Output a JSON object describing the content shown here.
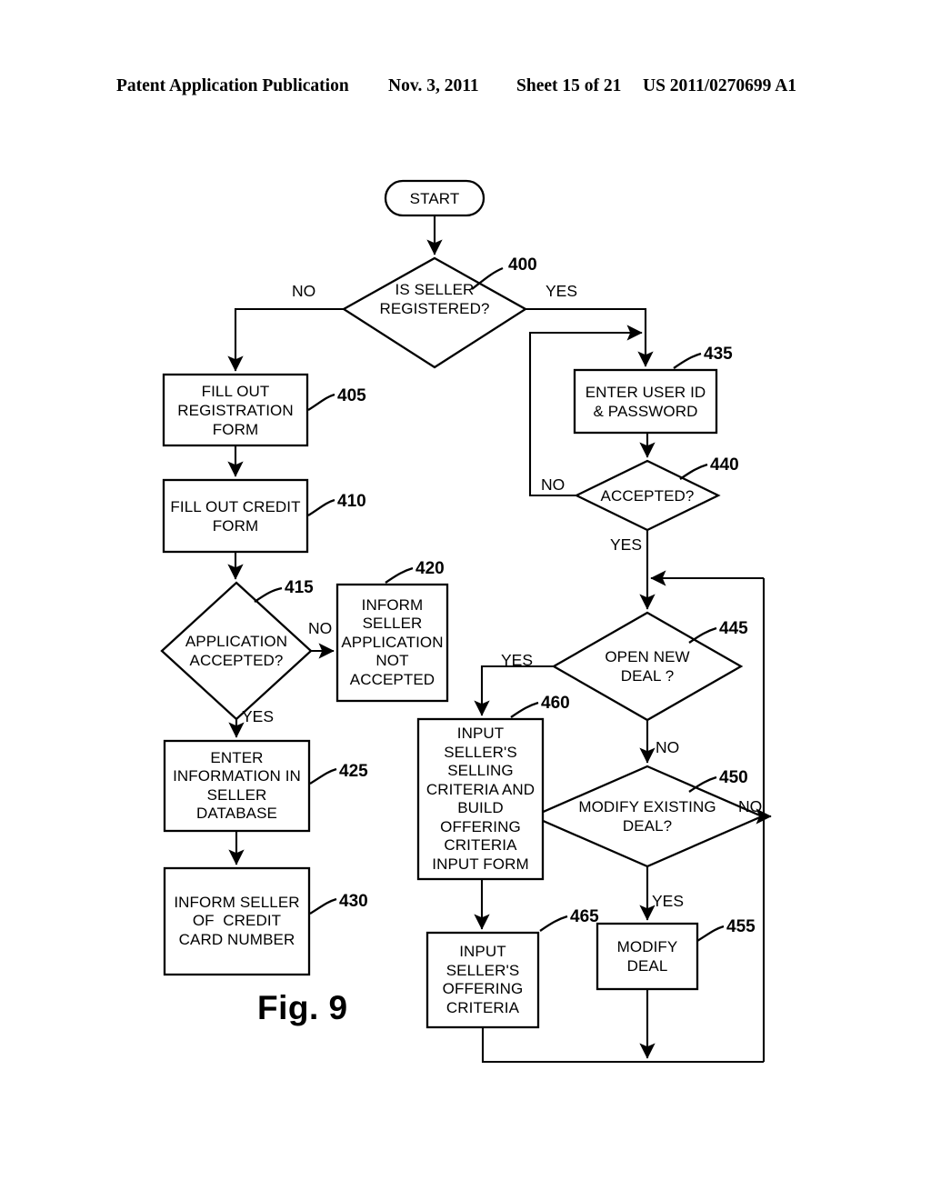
{
  "header": {
    "publication": "Patent Application Publication",
    "date": "Nov. 3, 2011",
    "sheet": "Sheet 15 of 21",
    "number": "US 2011/0270699 A1"
  },
  "figure": {
    "label": "Fig. 9"
  },
  "flowchart": {
    "type": "flowchart",
    "title": "Seller registration and deal management process",
    "nodes": [
      {
        "id": "start",
        "ref": "",
        "shape": "terminator",
        "text": "START"
      },
      {
        "id": "n400",
        "ref": "400",
        "shape": "decision",
        "text": "IS SELLER\nREGISTERED?"
      },
      {
        "id": "n405",
        "ref": "405",
        "shape": "process",
        "text": "FILL OUT\nREGISTRATION\nFORM"
      },
      {
        "id": "n410",
        "ref": "410",
        "shape": "process",
        "text": "FILL OUT CREDIT\nFORM"
      },
      {
        "id": "n415",
        "ref": "415",
        "shape": "decision",
        "text": "APPLICATION\nACCEPTED?"
      },
      {
        "id": "n420",
        "ref": "420",
        "shape": "process",
        "text": "INFORM\nSELLER\nAPPLICATION\nNOT\nACCEPTED"
      },
      {
        "id": "n425",
        "ref": "425",
        "shape": "process",
        "text": "ENTER\nINFORMATION IN\nSELLER\nDATABASE"
      },
      {
        "id": "n430",
        "ref": "430",
        "shape": "process",
        "text": "INFORM SELLER\nOF  CREDIT\nCARD NUMBER"
      },
      {
        "id": "n435",
        "ref": "435",
        "shape": "process",
        "text": "ENTER USER ID\n& PASSWORD"
      },
      {
        "id": "n440",
        "ref": "440",
        "shape": "decision",
        "text": "ACCEPTED?"
      },
      {
        "id": "n445",
        "ref": "445",
        "shape": "decision",
        "text": "OPEN NEW\nDEAL ?"
      },
      {
        "id": "n450",
        "ref": "450",
        "shape": "decision",
        "text": "MODIFY EXISTING\nDEAL?"
      },
      {
        "id": "n455",
        "ref": "455",
        "shape": "process",
        "text": "MODIFY\nDEAL"
      },
      {
        "id": "n460",
        "ref": "460",
        "shape": "process",
        "text": "INPUT\nSELLER'S\nSELLING\nCRITERIA AND\nBUILD\nOFFERING\nCRITERIA\nINPUT FORM"
      },
      {
        "id": "n465",
        "ref": "465",
        "shape": "process",
        "text": "INPUT\nSELLER'S\nOFFERING\nCRITERIA"
      }
    ],
    "edges": [
      {
        "from": "start",
        "to": "n400",
        "label": ""
      },
      {
        "from": "n400",
        "to": "n405",
        "label": "NO"
      },
      {
        "from": "n400",
        "to": "n435",
        "label": "YES"
      },
      {
        "from": "n405",
        "to": "n410",
        "label": ""
      },
      {
        "from": "n410",
        "to": "n415",
        "label": ""
      },
      {
        "from": "n415",
        "to": "n420",
        "label": "NO"
      },
      {
        "from": "n415",
        "to": "n425",
        "label": "YES"
      },
      {
        "from": "n425",
        "to": "n430",
        "label": ""
      },
      {
        "from": "n435",
        "to": "n440",
        "label": ""
      },
      {
        "from": "n440",
        "to": "n435",
        "label": "NO"
      },
      {
        "from": "n440",
        "to": "n445",
        "label": "YES"
      },
      {
        "from": "n445",
        "to": "n460",
        "label": "YES"
      },
      {
        "from": "n445",
        "to": "n450",
        "label": "NO"
      },
      {
        "from": "n450",
        "to": "n455",
        "label": "YES"
      },
      {
        "from": "n450",
        "to": "n445",
        "label": "NO"
      },
      {
        "from": "n455",
        "to": "n445",
        "label": ""
      },
      {
        "from": "n460",
        "to": "n465",
        "label": ""
      },
      {
        "from": "n465",
        "to": "n445",
        "label": ""
      }
    ],
    "branch_labels": {
      "no_400": "NO",
      "yes_400": "YES",
      "no_415": "NO",
      "yes_415": "YES",
      "no_440": "NO",
      "yes_440": "YES",
      "yes_445": "YES",
      "no_445": "NO",
      "no_450": "NO",
      "yes_450": "YES"
    },
    "colors": {
      "line": "#000000",
      "fill": "#ffffff",
      "text": "#000000"
    }
  }
}
